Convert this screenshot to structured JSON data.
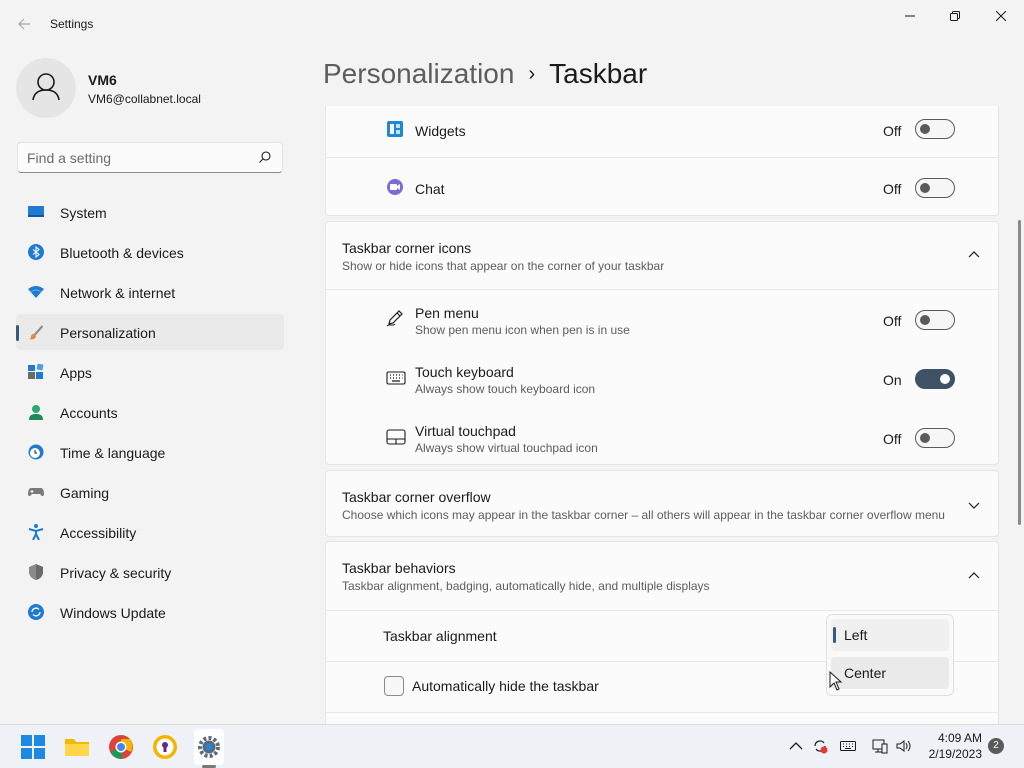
{
  "app": {
    "title": "Settings"
  },
  "user": {
    "name": "VM6",
    "email": "VM6@collabnet.local"
  },
  "search": {
    "placeholder": "Find a setting"
  },
  "sidebar": {
    "items": [
      {
        "label": "System",
        "icon": "system-icon"
      },
      {
        "label": "Bluetooth & devices",
        "icon": "bluetooth-icon"
      },
      {
        "label": "Network & internet",
        "icon": "wifi-icon"
      },
      {
        "label": "Personalization",
        "icon": "brush-icon",
        "active": true
      },
      {
        "label": "Apps",
        "icon": "apps-icon"
      },
      {
        "label": "Accounts",
        "icon": "accounts-icon"
      },
      {
        "label": "Time & language",
        "icon": "clock-globe-icon"
      },
      {
        "label": "Gaming",
        "icon": "gamepad-icon"
      },
      {
        "label": "Accessibility",
        "icon": "accessibility-icon"
      },
      {
        "label": "Privacy & security",
        "icon": "shield-icon"
      },
      {
        "label": "Windows Update",
        "icon": "update-icon"
      }
    ]
  },
  "header": {
    "parent": "Personalization",
    "separator": "›",
    "current": "Taskbar"
  },
  "taskbar_items": {
    "widgets": {
      "label": "Widgets",
      "state": "Off"
    },
    "chat": {
      "label": "Chat",
      "state": "Off"
    }
  },
  "corner_icons": {
    "title": "Taskbar corner icons",
    "description": "Show or hide icons that appear on the corner of your taskbar",
    "items": [
      {
        "label": "Pen menu",
        "description": "Show pen menu icon when pen is in use",
        "state": "Off",
        "icon": "pen-icon"
      },
      {
        "label": "Touch keyboard",
        "description": "Always show touch keyboard icon",
        "state": "On",
        "icon": "keyboard-icon"
      },
      {
        "label": "Virtual touchpad",
        "description": "Always show virtual touchpad icon",
        "state": "Off",
        "icon": "touchpad-icon"
      }
    ]
  },
  "corner_overflow": {
    "title": "Taskbar corner overflow",
    "description": "Choose which icons may appear in the taskbar corner – all others will appear in the taskbar corner overflow menu"
  },
  "behaviors": {
    "title": "Taskbar behaviors",
    "description": "Taskbar alignment, badging, automatically hide, and multiple displays",
    "alignment_label": "Taskbar alignment",
    "alignment_options": [
      "Left",
      "Center"
    ],
    "alignment_selected": "Left",
    "autohide_label": "Automatically hide the taskbar"
  },
  "system_tray": {
    "time": "4:09 AM",
    "date": "2/19/2023",
    "notifications": "2"
  },
  "colors": {
    "accent": "#3e5165",
    "toggle_on": "#3e5165"
  }
}
